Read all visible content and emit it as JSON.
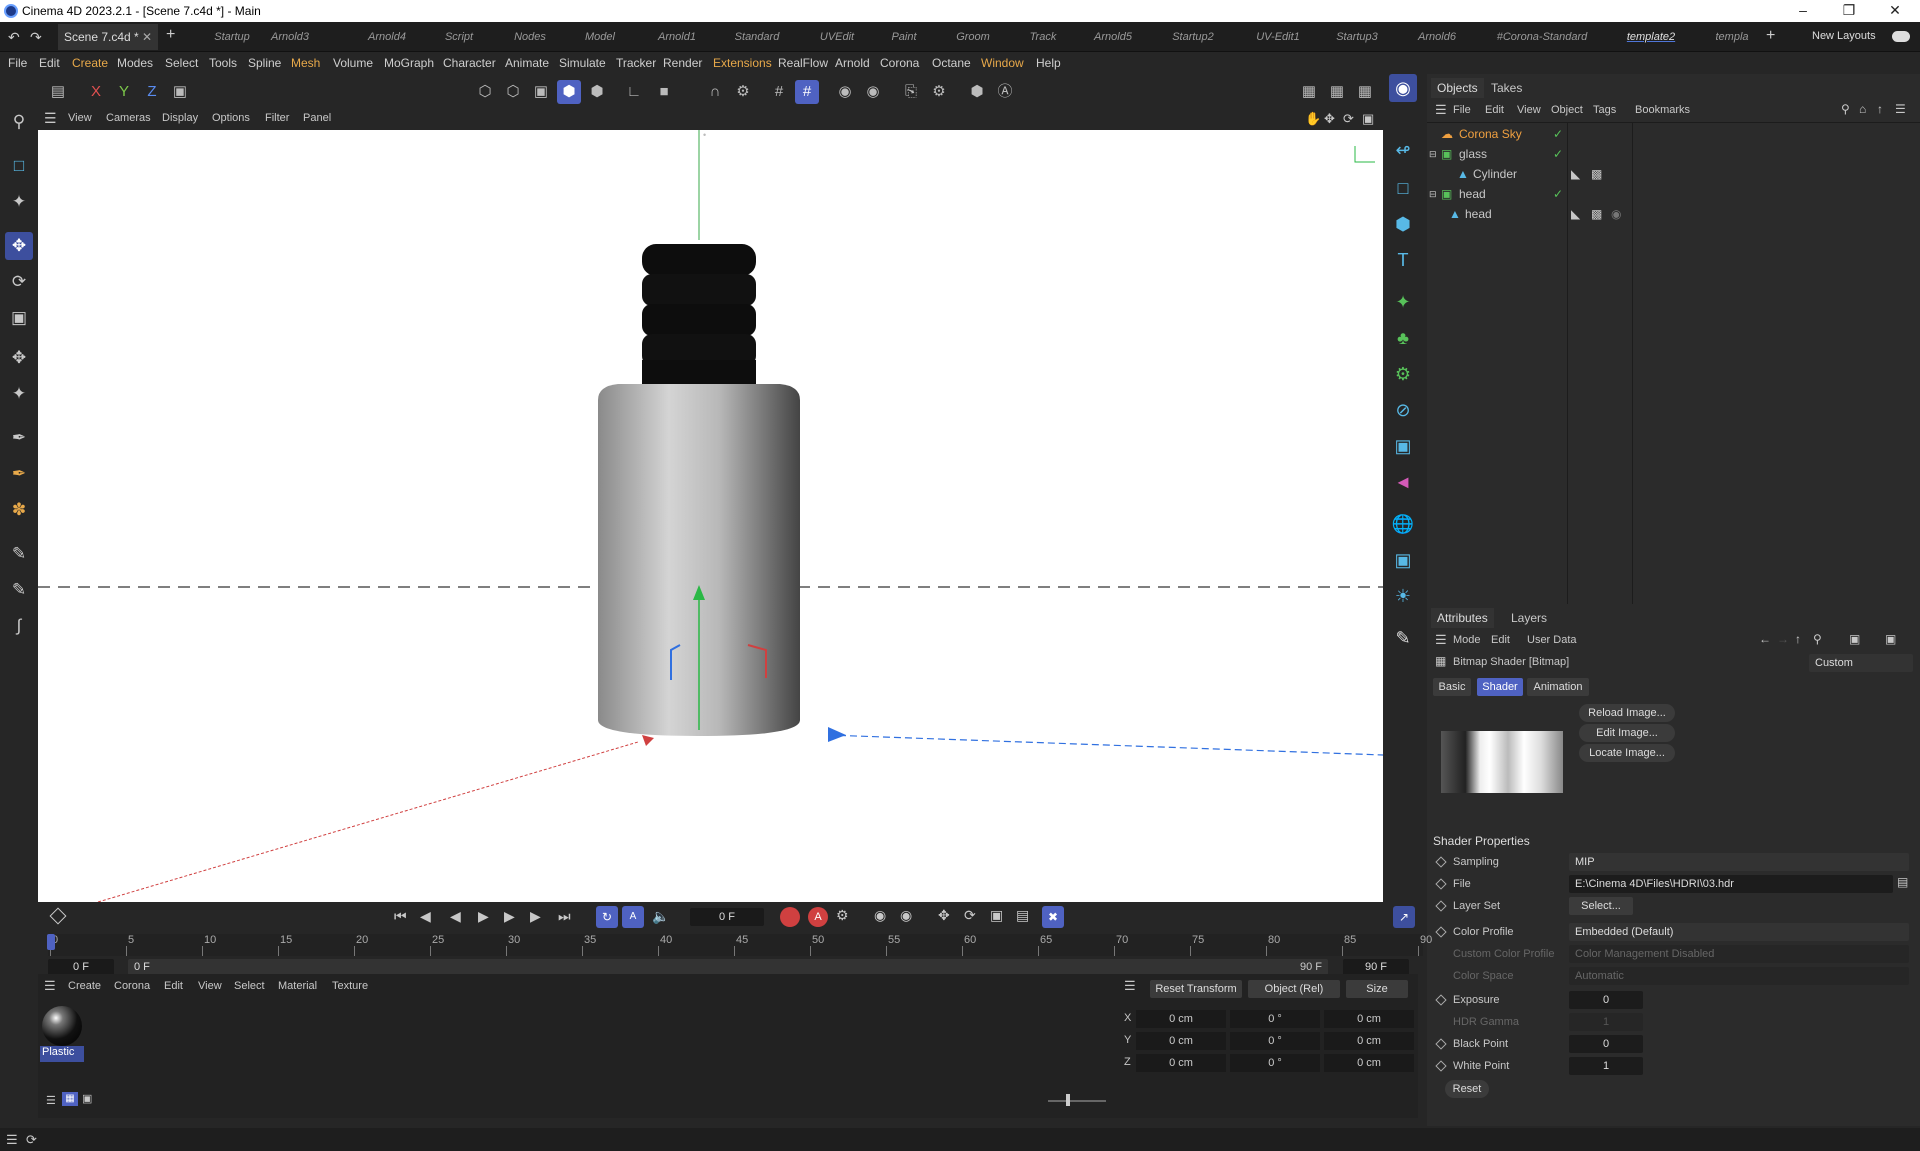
{
  "window": {
    "title": "Cinema 4D 2023.2.1 - [Scene 7.c4d *] - Main"
  },
  "tabs": {
    "scene": "Scene 7.c4d *",
    "layouts": [
      "Startup",
      "Arnold3",
      "Arnold4",
      "Script",
      "Nodes",
      "Model",
      "Arnold1",
      "Standard",
      "UVEdit",
      "Paint",
      "Groom",
      "Track",
      "Arnold5",
      "Startup2",
      "UV-Edit1",
      "Startup3",
      "Arnold6",
      "#Corona-Standard",
      "template2",
      "templa"
    ],
    "active_layout": "template2",
    "new_layouts": "New Layouts"
  },
  "menu": [
    "File",
    "Edit",
    "Create",
    "Modes",
    "Select",
    "Tools",
    "Spline",
    "Mesh",
    "Volume",
    "MoGraph",
    "Character",
    "Animate",
    "Simulate",
    "Tracker",
    "Render",
    "Extensions",
    "RealFlow",
    "Arnold",
    "Corona",
    "Octane",
    "Window",
    "Help"
  ],
  "axis_toggles": [
    "X",
    "Y",
    "Z"
  ],
  "viewport_menu": [
    "View",
    "Cameras",
    "Display",
    "Options",
    "Filter",
    "Panel"
  ],
  "objects_panel": {
    "tabs": [
      "Objects",
      "Takes"
    ],
    "menu": [
      "File",
      "Edit",
      "View",
      "Object",
      "Tags",
      "Bookmarks"
    ],
    "rows": [
      {
        "name": "Corona Sky",
        "highlight": true
      },
      {
        "name": "glass",
        "highlight": false
      },
      {
        "name": "Cylinder",
        "highlight": false
      },
      {
        "name": "head",
        "highlight": false
      },
      {
        "name": "head",
        "highlight": false
      }
    ]
  },
  "attributes_panel": {
    "tabs": [
      "Attributes",
      "Layers"
    ],
    "menu": [
      "Mode",
      "Edit",
      "User Data"
    ],
    "title": "Bitmap Shader [Bitmap]",
    "preset": "Custom",
    "subtabs": [
      "Basic",
      "Shader",
      "Animation"
    ],
    "active_subtab": "Shader",
    "image_buttons": [
      "Reload Image...",
      "Edit Image...",
      "Locate Image..."
    ],
    "section": "Shader Properties",
    "props": {
      "sampling": {
        "label": "Sampling",
        "value": "MIP"
      },
      "file": {
        "label": "File",
        "value": "E:\\Cinema 4D\\Files\\HDRI\\03.hdr"
      },
      "layer_set": {
        "label": "Layer Set",
        "value": "Select..."
      },
      "color_profile": {
        "label": "Color Profile",
        "value": "Embedded (Default)"
      },
      "custom_color_profile": {
        "label": "Custom Color Profile",
        "value": "Color Management Disabled"
      },
      "color_space": {
        "label": "Color Space",
        "value": "Automatic"
      },
      "exposure": {
        "label": "Exposure",
        "value": "0"
      },
      "hdr_gamma": {
        "label": "HDR Gamma",
        "value": "1"
      },
      "black_point": {
        "label": "Black Point",
        "value": "0"
      },
      "white_point": {
        "label": "White Point",
        "value": "1"
      }
    },
    "reset": "Reset"
  },
  "timeline": {
    "current_frame": "0 F",
    "start": "0 F",
    "range_start": "0 F",
    "range_end": "90 F",
    "end": "90 F",
    "ticks": [
      "0",
      "5",
      "10",
      "15",
      "20",
      "25",
      "30",
      "35",
      "40",
      "45",
      "50",
      "55",
      "60",
      "65",
      "70",
      "75",
      "80",
      "85",
      "90"
    ]
  },
  "material_panel": {
    "menu": [
      "Create",
      "Corona",
      "Edit",
      "View",
      "Select",
      "Material",
      "Texture"
    ],
    "materials": [
      "Plastic"
    ]
  },
  "coord_panel": {
    "reset": "Reset Transform",
    "mode": "Object (Rel)",
    "size": "Size",
    "rows": [
      {
        "axis": "X",
        "pos": "0 cm",
        "rot": "0 °",
        "size": "0 cm"
      },
      {
        "axis": "Y",
        "pos": "0 cm",
        "rot": "0 °",
        "size": "0 cm"
      },
      {
        "axis": "Z",
        "pos": "0 cm",
        "rot": "0 °",
        "size": "0 cm"
      }
    ]
  },
  "colors": {
    "accent": "#4f62c2",
    "highlight_menu": "#e8a94a",
    "corona": "#f0a040",
    "icon_blue": "#58b9e6",
    "icon_green": "#58c25a"
  }
}
